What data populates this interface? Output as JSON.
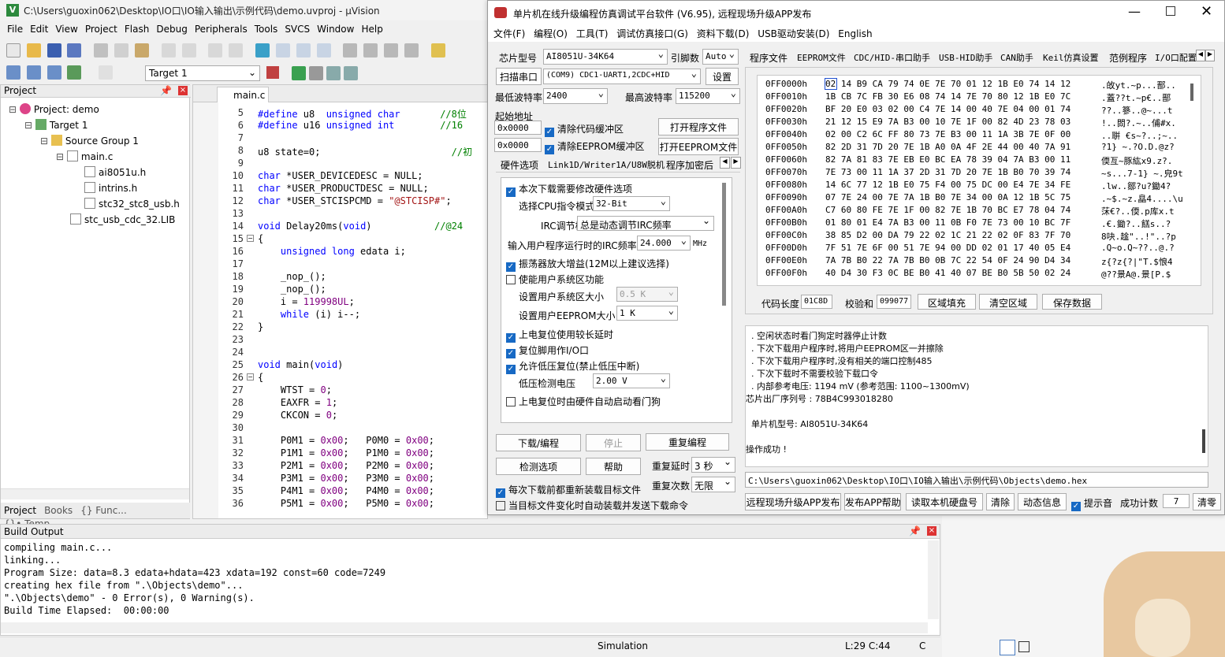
{
  "uv": {
    "title": "C:\\Users\\guoxin062\\Desktop\\IO口\\IO输入输出\\示例代码\\demo.uvproj - µVision",
    "menu": [
      "File",
      "Edit",
      "View",
      "Project",
      "Flash",
      "Debug",
      "Peripherals",
      "Tools",
      "SVCS",
      "Window",
      "Help"
    ],
    "target": "Target 1",
    "project_header": "Project",
    "tree": [
      "Project: demo",
      "Target 1",
      "Source Group 1",
      "main.c",
      "ai8051u.h",
      "intrins.h",
      "stc32_stc8_usb.h",
      "stc_usb_cdc_32.LIB"
    ],
    "bottom_tabs": [
      "Project",
      "Books",
      "{} Func...",
      "{}• Temp..."
    ],
    "editor_tab": "main.c",
    "code_lines": [
      {
        "n": "5",
        "t": [
          {
            "c": "kw",
            "s": "#define"
          },
          {
            "s": " u8  "
          },
          {
            "c": "kw",
            "s": "unsigned char"
          },
          {
            "s": "       "
          },
          {
            "c": "cmt",
            "s": "//8位"
          }
        ]
      },
      {
        "n": "6",
        "t": [
          {
            "c": "kw",
            "s": "#define"
          },
          {
            "s": " u16 "
          },
          {
            "c": "kw",
            "s": "unsigned int"
          },
          {
            "s": "        "
          },
          {
            "c": "cmt",
            "s": "//16"
          }
        ]
      },
      {
        "n": "7",
        "t": []
      },
      {
        "n": "8",
        "t": [
          {
            "s": "u8 state=0;"
          },
          {
            "s": "                       "
          },
          {
            "c": "cmt",
            "s": "//初"
          }
        ]
      },
      {
        "n": "9",
        "t": []
      },
      {
        "n": "10",
        "t": [
          {
            "c": "kw",
            "s": "char"
          },
          {
            "s": " *USER_DEVICEDESC = NULL;"
          }
        ]
      },
      {
        "n": "11",
        "t": [
          {
            "c": "kw",
            "s": "char"
          },
          {
            "s": " *USER_PRODUCTDESC = NULL;"
          }
        ]
      },
      {
        "n": "12",
        "t": [
          {
            "c": "kw",
            "s": "char"
          },
          {
            "s": " *USER_STCISPCMD = "
          },
          {
            "c": "str",
            "s": "\"@STCISP#\""
          },
          {
            "s": ";"
          }
        ]
      },
      {
        "n": "13",
        "t": []
      },
      {
        "n": "14",
        "t": [
          {
            "c": "kw",
            "s": "void"
          },
          {
            "s": " Delay20ms("
          },
          {
            "c": "kw",
            "s": "void"
          },
          {
            "s": ")"
          },
          {
            "s": "           "
          },
          {
            "c": "cmt",
            "s": "//@24"
          }
        ]
      },
      {
        "n": "15",
        "t": [
          {
            "s": "{"
          }
        ]
      },
      {
        "n": "16",
        "t": [
          {
            "s": "    "
          },
          {
            "c": "kw",
            "s": "unsigned long"
          },
          {
            "s": " edata i;"
          }
        ]
      },
      {
        "n": "17",
        "t": []
      },
      {
        "n": "18",
        "t": [
          {
            "s": "    _nop_();"
          }
        ]
      },
      {
        "n": "19",
        "t": [
          {
            "s": "    _nop_();"
          }
        ]
      },
      {
        "n": "20",
        "t": [
          {
            "s": "    i = "
          },
          {
            "c": "num",
            "s": "119998UL"
          },
          {
            "s": ";"
          }
        ]
      },
      {
        "n": "21",
        "t": [
          {
            "s": "    "
          },
          {
            "c": "kw",
            "s": "while"
          },
          {
            "s": " (i) i--;"
          }
        ]
      },
      {
        "n": "22",
        "t": [
          {
            "s": "}"
          }
        ]
      },
      {
        "n": "23",
        "t": []
      },
      {
        "n": "24",
        "t": []
      },
      {
        "n": "25",
        "t": [
          {
            "c": "kw",
            "s": "void"
          },
          {
            "s": " main("
          },
          {
            "c": "kw",
            "s": "void"
          },
          {
            "s": ")"
          }
        ]
      },
      {
        "n": "26",
        "t": [
          {
            "s": "{"
          }
        ]
      },
      {
        "n": "27",
        "t": [
          {
            "s": "    WTST = "
          },
          {
            "c": "num",
            "s": "0"
          },
          {
            "s": ";"
          }
        ]
      },
      {
        "n": "28",
        "t": [
          {
            "s": "    EAXFR = "
          },
          {
            "c": "num",
            "s": "1"
          },
          {
            "s": ";"
          }
        ]
      },
      {
        "n": "29",
        "t": [
          {
            "s": "    CKCON = "
          },
          {
            "c": "num",
            "s": "0"
          },
          {
            "s": ";"
          }
        ]
      },
      {
        "n": "30",
        "t": []
      },
      {
        "n": "31",
        "t": [
          {
            "s": "    P0M1 = "
          },
          {
            "c": "num",
            "s": "0x00"
          },
          {
            "s": ";   P0M0 = "
          },
          {
            "c": "num",
            "s": "0x00"
          },
          {
            "s": ";"
          }
        ]
      },
      {
        "n": "32",
        "t": [
          {
            "s": "    P1M1 = "
          },
          {
            "c": "num",
            "s": "0x00"
          },
          {
            "s": ";   P1M0 = "
          },
          {
            "c": "num",
            "s": "0x00"
          },
          {
            "s": ";"
          }
        ]
      },
      {
        "n": "33",
        "t": [
          {
            "s": "    P2M1 = "
          },
          {
            "c": "num",
            "s": "0x00"
          },
          {
            "s": ";   P2M0 = "
          },
          {
            "c": "num",
            "s": "0x00"
          },
          {
            "s": ";"
          }
        ]
      },
      {
        "n": "34",
        "t": [
          {
            "s": "    P3M1 = "
          },
          {
            "c": "num",
            "s": "0x00"
          },
          {
            "s": ";   P3M0 = "
          },
          {
            "c": "num",
            "s": "0x00"
          },
          {
            "s": ";"
          }
        ]
      },
      {
        "n": "35",
        "t": [
          {
            "s": "    P4M1 = "
          },
          {
            "c": "num",
            "s": "0x00"
          },
          {
            "s": ";   P4M0 = "
          },
          {
            "c": "num",
            "s": "0x00"
          },
          {
            "s": ";"
          }
        ]
      },
      {
        "n": "36",
        "t": [
          {
            "s": "    P5M1 = "
          },
          {
            "c": "num",
            "s": "0x00"
          },
          {
            "s": ";   P5M0 = "
          },
          {
            "c": "num",
            "s": "0x00"
          },
          {
            "s": ";"
          }
        ]
      }
    ],
    "build_header": "Build Output",
    "build_lines": [
      "compiling main.c...",
      "linking...",
      "Program Size: data=8.3 edata+hdata=423 xdata=192 const=60 code=7249",
      "creating hex file from \".\\Objects\\demo\"...",
      "\".\\Objects\\demo\" - 0 Error(s), 0 Warning(s).",
      "Build Time Elapsed:  00:00:00"
    ],
    "status_mode": "Simulation",
    "status_pos": "L:29 C:44",
    "status_c": "C"
  },
  "stc": {
    "title": "单片机在线升级编程仿真调试平台软件 (V6.95), 远程现场升级APP发布",
    "menu": [
      "文件(F)",
      "编程(O)",
      "工具(T)",
      "调试仿真接口(G)",
      "资料下载(D)",
      "USB驱动安装(D)",
      "English"
    ],
    "chip_label": "芯片型号",
    "chip_value": "AI8051U-34K64",
    "pins_label": "引脚数",
    "pins_value": "Auto",
    "scan_btn": "扫描串口",
    "port_value": "(COM9) CDC1-UART1,2CDC+HID",
    "settings_btn": "设置",
    "min_baud_label": "最低波特率",
    "min_baud": "2400",
    "max_baud_label": "最高波特率",
    "max_baud": "115200",
    "start_addr_label": "起始地址",
    "addr1": "0x0000",
    "clear_code": "清除代码缓冲区",
    "open_prog": "打开程序文件",
    "addr2": "0x0000",
    "clear_eeprom": "清除EEPROM缓冲区",
    "open_eeprom": "打开EEPROM文件",
    "left_tabs": [
      "硬件选项",
      "Link1D/Writer1A/U8W脱机",
      "程序加密后"
    ],
    "hw": {
      "modify": "本次下载需要修改硬件选项",
      "cpu_mode_label": "选择CPU指令模式",
      "cpu_mode": "32-Bit",
      "irc_mode_label": "IRC调节模式",
      "irc_mode": "总是动态调节IRC频率",
      "irc_freq_label": "输入用户程序运行时的IRC频率",
      "irc_freq": "24.000",
      "mhz": "MHz",
      "osc_gain": "振荡器放大增益(12M以上建议选择)",
      "user_sys": "使能用户系统区功能",
      "sys_size_label": "设置用户系统区大小",
      "sys_size": "0.5 K",
      "eeprom_size_label": "设置用户EEPROM大小",
      "eeprom_size": "1  K",
      "por_delay": "上电复位使用较长延时",
      "reset_io": "复位脚用作I/O口",
      "lvr": "允许低压复位(禁止低压中断)",
      "lv_label": "低压检测电压",
      "lv_value": "2.00 V",
      "wdt": "上电复位时由硬件自动启动看门狗"
    },
    "download_btn": "下载/编程",
    "stop_btn": "停止",
    "reprog_btn": "重复编程",
    "check_btn": "检测选项",
    "help_btn": "帮助",
    "repeat_delay_label": "重复延时",
    "repeat_delay": "3 秒",
    "reload_chk": "每次下载前都重新装载目标文件",
    "repeat_count_label": "重复次数",
    "repeat_count": "无限",
    "auto_chk": "当目标文件变化时自动装载并发送下载命令",
    "right_tabs": [
      "程序文件",
      "EEPROM文件",
      "CDC/HID-串口助手",
      "USB-HID助手",
      "CAN助手",
      "Keil仿真设置",
      "范例程序",
      "I/O口配置"
    ],
    "hex_rows": [
      {
        "a": "0FF0000h",
        "h": "02 14 B9 CA 79 74 0E 7E 70 01 12 1B E0 74 14 12",
        "s": ".敀yt.~p...鄑.."
      },
      {
        "a": "0FF0010h",
        "h": "1B CB 7C FB 30 E6 08 74 14 7E 70 80 12 1B E0 7C",
        "s": ".蓋??t.~p€..鄑"
      },
      {
        "a": "0FF0020h",
        "h": "BF 20 E0 03 02 00 C4 7E 14 00 40 7E 04 00 01 74",
        "s": "??..篸..@~...t"
      },
      {
        "a": "0FF0030h",
        "h": "21 12 15 E9 7A B3 00 10 7E 1F 00 82 4D 23 78 03",
        "s": "!..閦?.~..俌#x."
      },
      {
        "a": "0FF0040h",
        "h": "02 00 C2 6C FF 80 73 7E B3 00 11 1A 3B 7E 0F 00",
        "s": "..聠 €s~?..;~.."
      },
      {
        "a": "0FF0050h",
        "h": "82 2D 31 7D 20 7E 1B A0 0A 4F 2E 44 00 40 7A 91",
        "s": "?1} ~.?O.D.@z?"
      },
      {
        "a": "0FF0060h",
        "h": "82 7A 81 83 7E EB E0 BC EA 78 39 04 7A B3 00 11",
        "s": "偄亙~豚紘x9.z?."
      },
      {
        "a": "0FF0070h",
        "h": "7E 73 00 11 1A 37 2D 31 7D 20 7E 1B B0 70 39 74",
        "s": "~s...7-1} ~.皃9t"
      },
      {
        "a": "0FF0080h",
        "h": "14 6C 77 12 1B E0 75 F4 00 75 DC 00 E4 7E 34 FE",
        "s": ".lw..鄒?u?鋤4?"
      },
      {
        "a": "0FF0090h",
        "h": "07 7E 24 00 7E 7A 1B B0 7E 34 00 0A 12 1B 5C 75",
        "s": ".~$.~z.皛4....\\u"
      },
      {
        "a": "0FF00A0h",
        "h": "C7 60 80 FE 7E 1F 00 82 7E 1B 70 BC E7 78 04 74",
        "s": "莯€?..偄.p库x.t"
      },
      {
        "a": "0FF00B0h",
        "h": "01 80 01 E4 7A B3 00 11 0B F0 7E 73 00 10 BC 7F",
        "s": ".€.鋤?..餻s..?"
      },
      {
        "a": "0FF00C0h",
        "h": "38 85 D2 00 DA 79 22 02 1C 21 22 02 0F 83 7F 70",
        "s": "8吷.趛\"..!\"..?p"
      },
      {
        "a": "0FF00D0h",
        "h": "7F 51 7E 6F 00 51 7E 94 00 DD 02 01 17 40 05 E4",
        "s": ".Q~o.Q~??..@.?"
      },
      {
        "a": "0FF00E0h",
        "h": "7A 7B B0 22 7A 7B B0 0B 7C 22 54 0F 24 90 D4 34",
        "s": "z{?z{?|\"T.$悢4"
      },
      {
        "a": "0FF00F0h",
        "h": "40 D4 30 F3 0C BE B0 41 40 07 BE B0 5B 50 02 24",
        "s": "@??景A@.景[P.$"
      }
    ],
    "code_len_label": "代码长度",
    "code_len": "01C8D",
    "checksum_label": "校验和",
    "checksum": "099077",
    "fill_btn": "区域填充",
    "clear_area_btn": "清空区域",
    "save_btn": "保存数据",
    "log_lines": [
      "  . 空闲状态时看门狗定时器停止计数",
      "  . 下次下载用户程序时,将用户EEPROM区一并擦除",
      "  . 下次下载用户程序时,没有相关的端口控制485",
      "  . 下次下载时不需要校验下载口令",
      "  . 内部参考电压: 1194 mV (参考范围: 1100~1300mV)",
      "芯片出厂序列号 : 78B4C993018280",
      "",
      "  单片机型号: AI8051U-34K64",
      "",
      "操作成功 !"
    ],
    "hex_path": "C:\\Users\\guoxin062\\Desktop\\IO口\\IO输入输出\\示例代码\\Objects\\demo.hex",
    "bottom_btns": [
      "远程现场升级APP发布",
      "发布APP帮助",
      "读取本机硬盘号",
      "清除",
      "动态信息"
    ],
    "beep": "提示音",
    "success_label": "成功计数",
    "success_count": "7",
    "clear_btn": "清零"
  }
}
